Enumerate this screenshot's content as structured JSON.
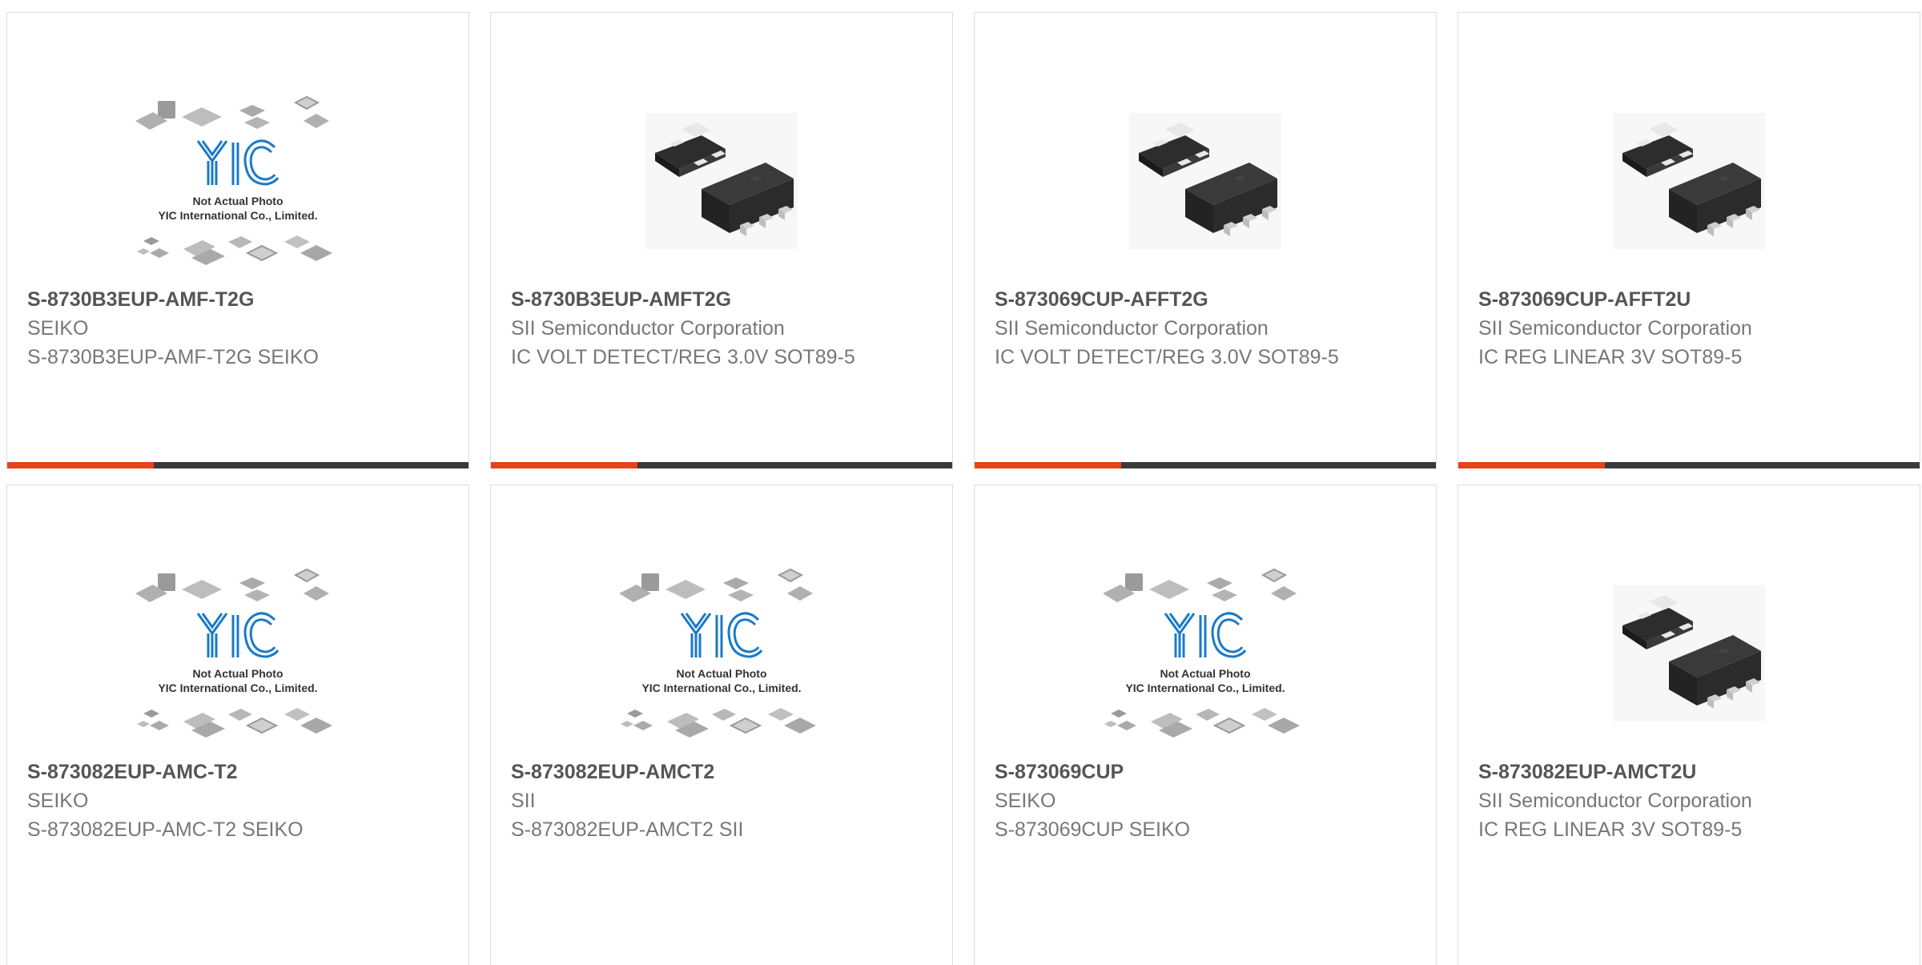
{
  "colors": {
    "accent": "#e5431b",
    "bar": "#3a3a3a",
    "part_number": "#555555",
    "text": "#777777",
    "logo": "#1a7ac8"
  },
  "placeholder": {
    "line1": "Not Actual Photo",
    "line2": "YIC International Co., Limited.",
    "logo_text": "YIC"
  },
  "products": [
    {
      "part_number": "S-8730B3EUP-AMF-T2G",
      "manufacturer": "SEIKO",
      "description": "S-8730B3EUP-AMF-T2G SEIKO",
      "image": "placeholder-icon"
    },
    {
      "part_number": "S-8730B3EUP-AMFT2G",
      "manufacturer": "SII Semiconductor Corporation",
      "description": "IC VOLT DETECT/REG 3.0V SOT89-5",
      "image": "sot89-package-icon"
    },
    {
      "part_number": "S-873069CUP-AFFT2G",
      "manufacturer": "SII Semiconductor Corporation",
      "description": "IC VOLT DETECT/REG 3.0V SOT89-5",
      "image": "sot89-package-icon"
    },
    {
      "part_number": "S-873069CUP-AFFT2U",
      "manufacturer": "SII Semiconductor Corporation",
      "description": "IC REG LINEAR 3V SOT89-5",
      "image": "sot89-package-icon"
    },
    {
      "part_number": "S-873082EUP-AMC-T2",
      "manufacturer": "SEIKO",
      "description": "S-873082EUP-AMC-T2 SEIKO",
      "image": "placeholder-icon"
    },
    {
      "part_number": "S-873082EUP-AMCT2",
      "manufacturer": "SII",
      "description": "S-873082EUP-AMCT2 SII",
      "image": "placeholder-icon"
    },
    {
      "part_number": "S-873069CUP",
      "manufacturer": "SEIKO",
      "description": "S-873069CUP SEIKO",
      "image": "placeholder-icon"
    },
    {
      "part_number": "S-873082EUP-AMCT2U",
      "manufacturer": "SII Semiconductor Corporation",
      "description": "IC REG LINEAR 3V SOT89-5",
      "image": "sot89-package-icon"
    }
  ]
}
